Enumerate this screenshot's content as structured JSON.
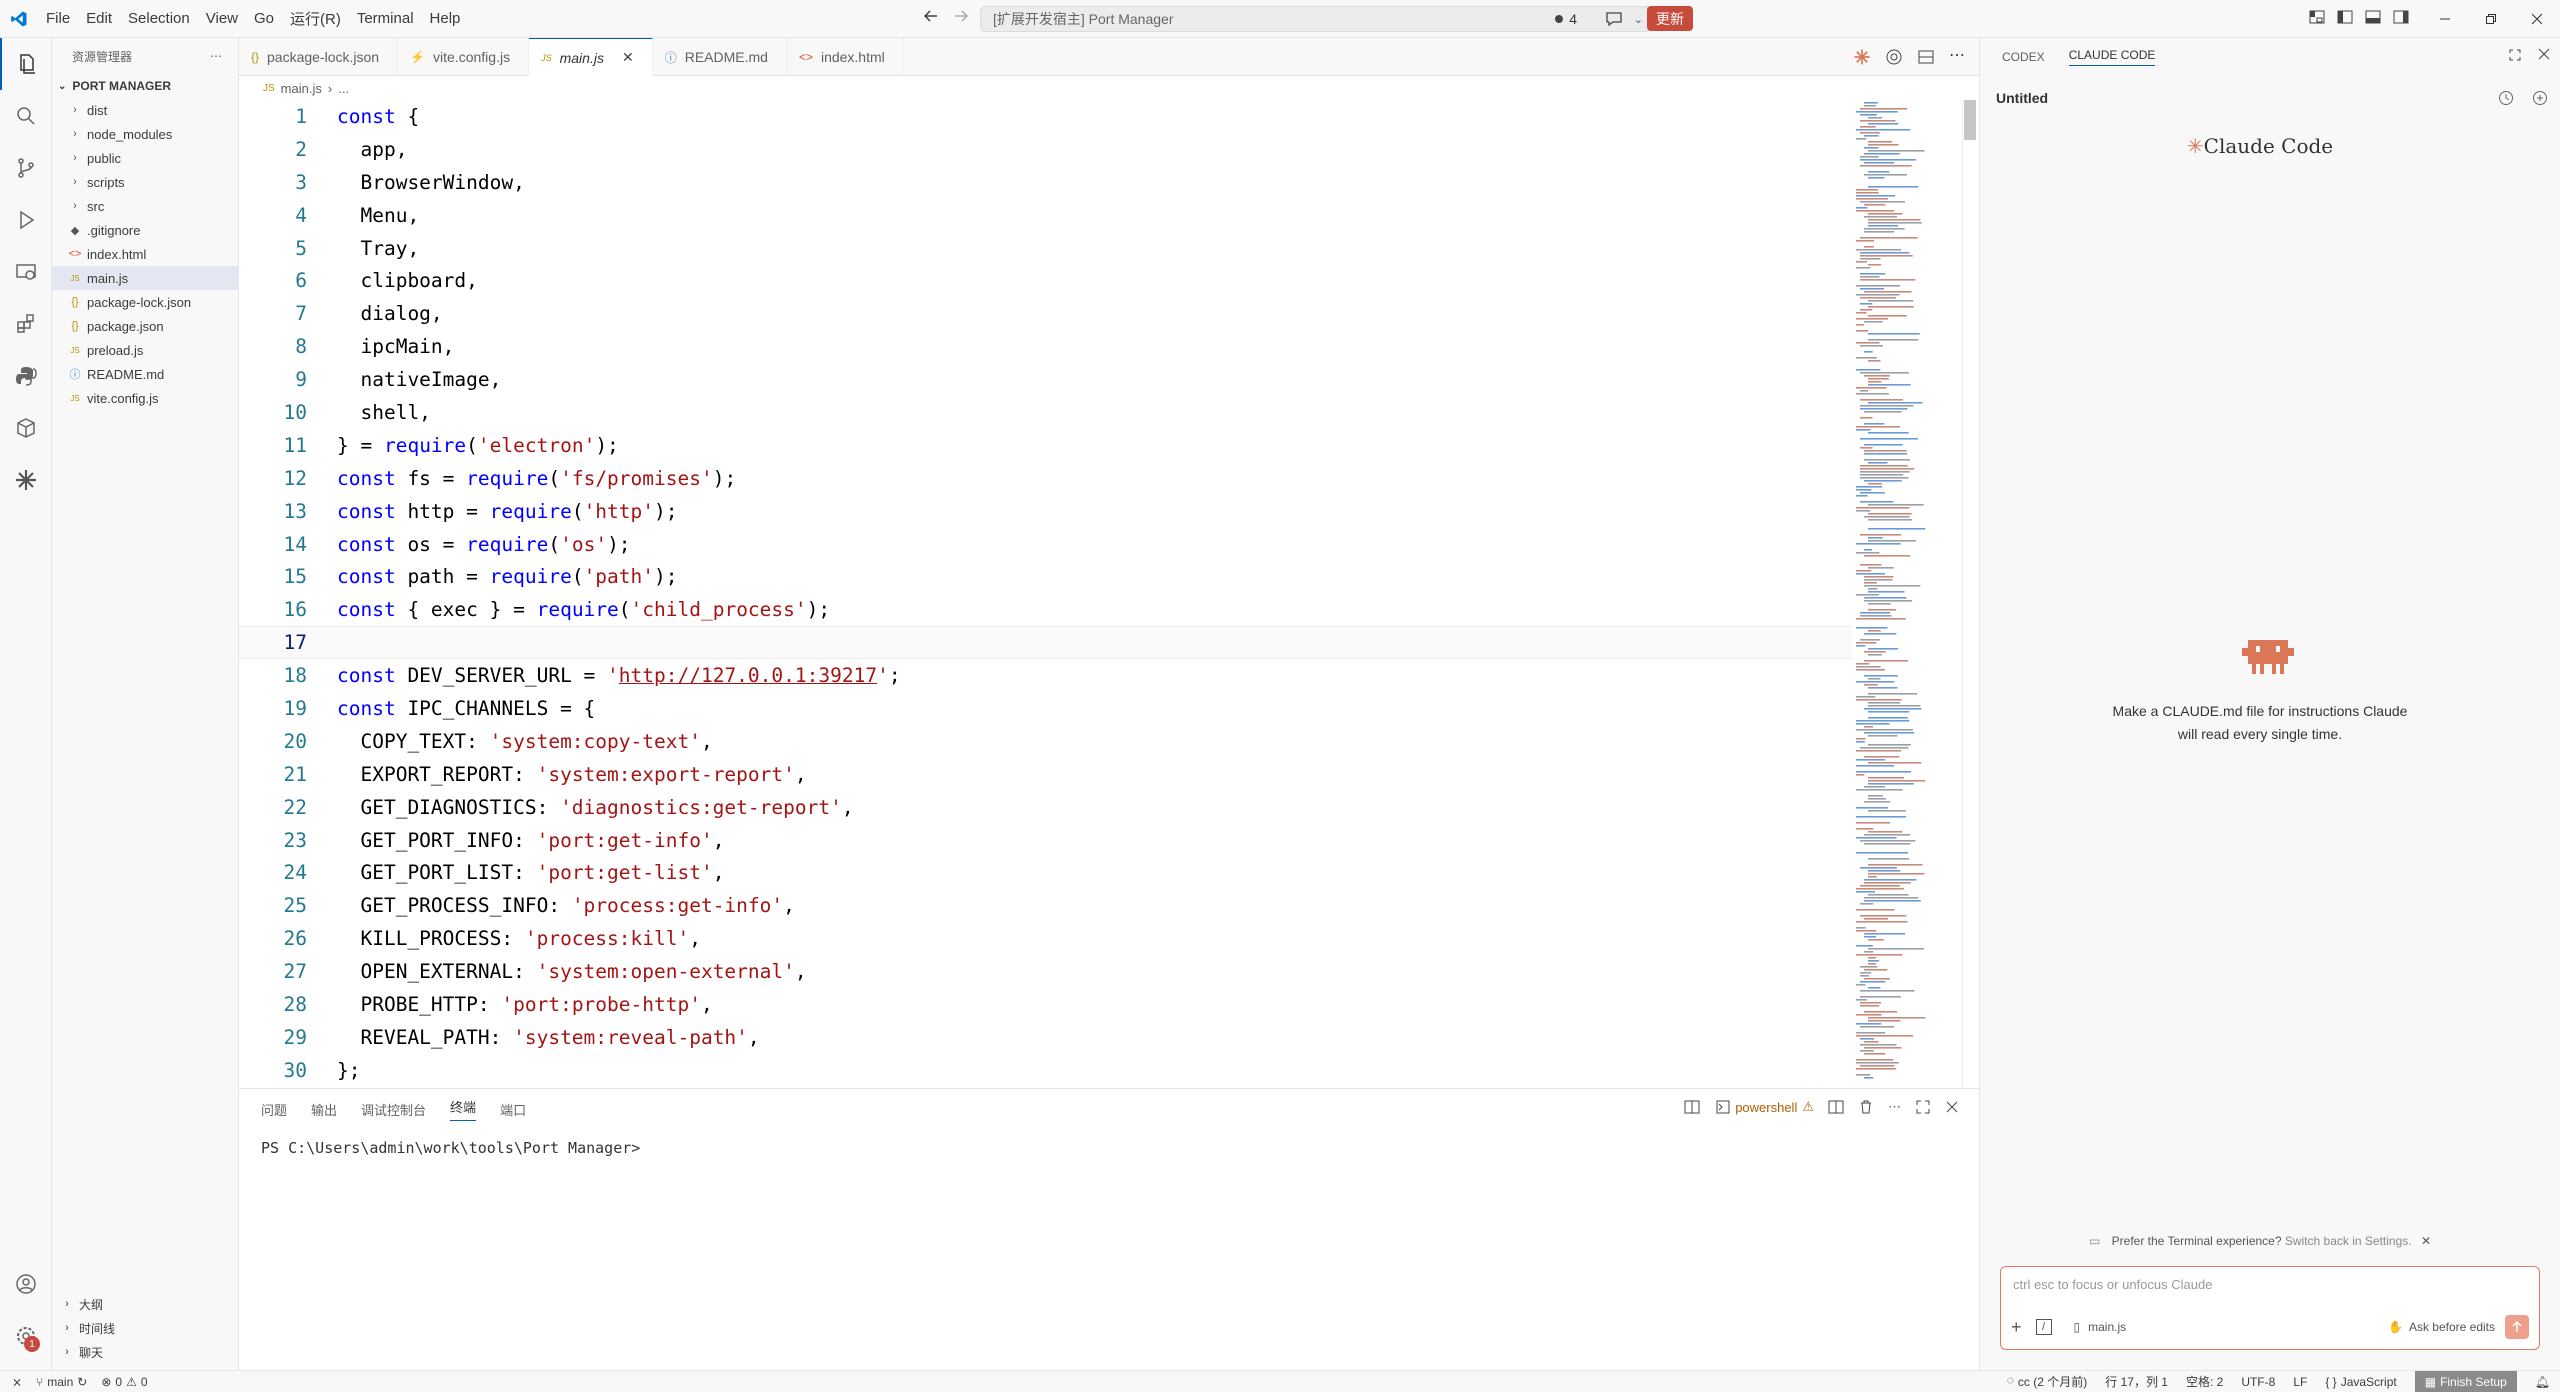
{
  "titlebar": {
    "menus": [
      "File",
      "Edit",
      "Selection",
      "View",
      "Go",
      "运行(R)",
      "Terminal",
      "Help"
    ],
    "command_center": "[扩展开发宿主] Port Manager",
    "badge_count": "4",
    "update_label": "更新"
  },
  "explorer": {
    "header": "资源管理器",
    "project": "PORT MANAGER",
    "items": [
      {
        "label": "dist",
        "kind": "folder"
      },
      {
        "label": "node_modules",
        "kind": "folder"
      },
      {
        "label": "public",
        "kind": "folder"
      },
      {
        "label": "scripts",
        "kind": "folder"
      },
      {
        "label": "src",
        "kind": "folder"
      },
      {
        "label": ".gitignore",
        "kind": "git"
      },
      {
        "label": "index.html",
        "kind": "html"
      },
      {
        "label": "main.js",
        "kind": "js",
        "selected": true
      },
      {
        "label": "package-lock.json",
        "kind": "json"
      },
      {
        "label": "package.json",
        "kind": "json"
      },
      {
        "label": "preload.js",
        "kind": "js"
      },
      {
        "label": "README.md",
        "kind": "md"
      },
      {
        "label": "vite.config.js",
        "kind": "js"
      }
    ],
    "bottom_sections": [
      "大纲",
      "时间线",
      "聊天"
    ]
  },
  "tabs": [
    {
      "label": "package-lock.json",
      "icon": "{}"
    },
    {
      "label": "vite.config.js",
      "icon": "⚡"
    },
    {
      "label": "main.js",
      "icon": "JS",
      "active": true
    },
    {
      "label": "README.md",
      "icon": "ⓘ"
    },
    {
      "label": "index.html",
      "icon": "<>"
    }
  ],
  "breadcrumb": {
    "file": "main.js",
    "rest": "..."
  },
  "code": {
    "current_line": 17,
    "lines": [
      [
        [
          "kw",
          "const"
        ],
        [
          "t",
          " {"
        ]
      ],
      [
        [
          "t",
          "  app,"
        ]
      ],
      [
        [
          "t",
          "  BrowserWindow,"
        ]
      ],
      [
        [
          "t",
          "  Menu,"
        ]
      ],
      [
        [
          "t",
          "  Tray,"
        ]
      ],
      [
        [
          "t",
          "  clipboard,"
        ]
      ],
      [
        [
          "t",
          "  dialog,"
        ]
      ],
      [
        [
          "t",
          "  ipcMain,"
        ]
      ],
      [
        [
          "t",
          "  nativeImage,"
        ]
      ],
      [
        [
          "t",
          "  shell,"
        ]
      ],
      [
        [
          "t",
          "} = "
        ],
        [
          "kw",
          "require"
        ],
        [
          "t",
          "("
        ],
        [
          "st",
          "'electron'"
        ],
        [
          "t",
          ");"
        ]
      ],
      [
        [
          "kw",
          "const"
        ],
        [
          "t",
          " fs = "
        ],
        [
          "kw",
          "require"
        ],
        [
          "t",
          "("
        ],
        [
          "st",
          "'fs/promises'"
        ],
        [
          "t",
          ");"
        ]
      ],
      [
        [
          "kw",
          "const"
        ],
        [
          "t",
          " http = "
        ],
        [
          "kw",
          "require"
        ],
        [
          "t",
          "("
        ],
        [
          "st",
          "'http'"
        ],
        [
          "t",
          ");"
        ]
      ],
      [
        [
          "kw",
          "const"
        ],
        [
          "t",
          " os = "
        ],
        [
          "kw",
          "require"
        ],
        [
          "t",
          "("
        ],
        [
          "st",
          "'os'"
        ],
        [
          "t",
          ");"
        ]
      ],
      [
        [
          "kw",
          "const"
        ],
        [
          "t",
          " path = "
        ],
        [
          "kw",
          "require"
        ],
        [
          "t",
          "("
        ],
        [
          "st",
          "'path'"
        ],
        [
          "t",
          ");"
        ]
      ],
      [
        [
          "kw",
          "const"
        ],
        [
          "t",
          " { exec } = "
        ],
        [
          "kw",
          "require"
        ],
        [
          "t",
          "("
        ],
        [
          "st",
          "'child_process'"
        ],
        [
          "t",
          ");"
        ]
      ],
      [],
      [
        [
          "kw",
          "const"
        ],
        [
          "t",
          " DEV_SERVER_URL = "
        ],
        [
          "st",
          "'"
        ],
        [
          "url",
          "http://127.0.0.1:39217"
        ],
        [
          "st",
          "'"
        ],
        [
          "t",
          ";"
        ]
      ],
      [
        [
          "kw",
          "const"
        ],
        [
          "t",
          " IPC_CHANNELS = {"
        ]
      ],
      [
        [
          "t",
          "  COPY_TEXT: "
        ],
        [
          "st",
          "'system:copy-text'"
        ],
        [
          "t",
          ","
        ]
      ],
      [
        [
          "t",
          "  EXPORT_REPORT: "
        ],
        [
          "st",
          "'system:export-report'"
        ],
        [
          "t",
          ","
        ]
      ],
      [
        [
          "t",
          "  GET_DIAGNOSTICS: "
        ],
        [
          "st",
          "'diagnostics:get-report'"
        ],
        [
          "t",
          ","
        ]
      ],
      [
        [
          "t",
          "  GET_PORT_INFO: "
        ],
        [
          "st",
          "'port:get-info'"
        ],
        [
          "t",
          ","
        ]
      ],
      [
        [
          "t",
          "  GET_PORT_LIST: "
        ],
        [
          "st",
          "'port:get-list'"
        ],
        [
          "t",
          ","
        ]
      ],
      [
        [
          "t",
          "  GET_PROCESS_INFO: "
        ],
        [
          "st",
          "'process:get-info'"
        ],
        [
          "t",
          ","
        ]
      ],
      [
        [
          "t",
          "  KILL_PROCESS: "
        ],
        [
          "st",
          "'process:kill'"
        ],
        [
          "t",
          ","
        ]
      ],
      [
        [
          "t",
          "  OPEN_EXTERNAL: "
        ],
        [
          "st",
          "'system:open-external'"
        ],
        [
          "t",
          ","
        ]
      ],
      [
        [
          "t",
          "  PROBE_HTTP: "
        ],
        [
          "st",
          "'port:probe-http'"
        ],
        [
          "t",
          ","
        ]
      ],
      [
        [
          "t",
          "  REVEAL_PATH: "
        ],
        [
          "st",
          "'system:reveal-path'"
        ],
        [
          "t",
          ","
        ]
      ],
      [
        [
          "t",
          "};"
        ]
      ]
    ]
  },
  "panel": {
    "tabs": [
      "问题",
      "输出",
      "调试控制台",
      "终端",
      "端口"
    ],
    "active_tab": "终端",
    "shell_label": "powershell",
    "prompt": "PS C:\\Users\\admin\\work\\tools\\Port Manager>"
  },
  "claude": {
    "tabs": [
      "CODEX",
      "CLAUDE CODE"
    ],
    "active_tab": "CLAUDE CODE",
    "session_title": "Untitled",
    "logo_text": "Claude Code",
    "hint_line1": "Make a CLAUDE.md file for instructions Claude",
    "hint_line2": "will read every single time.",
    "pref_text": "Prefer the Terminal experience?",
    "pref_link": "Switch back in Settings.",
    "input_placeholder": "ctrl esc to focus or unfocus Claude",
    "file_chip": "main.js",
    "mode_label": "Ask before edits"
  },
  "statusbar": {
    "branch": "main",
    "errors": "0",
    "warnings": "0",
    "cc": "cc (2 个月前)",
    "position": "行 17，列 1",
    "spaces": "空格: 2",
    "encoding": "UTF-8",
    "eol": "LF",
    "language": "JavaScript",
    "finish_setup": "Finish Setup"
  },
  "colors": {
    "accent": "#005fb8",
    "update_button": "#c64b3b",
    "claude_orange": "#d97757"
  }
}
